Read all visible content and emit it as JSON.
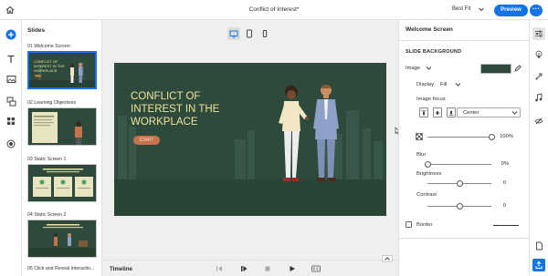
{
  "header": {
    "doc_title": "Conflict of Interest*",
    "fit_label": "Best Fit",
    "preview_label": "Preview",
    "more_label": "···"
  },
  "slides_panel": {
    "title": "Slides",
    "items": [
      {
        "label": "01  Welcome Screen",
        "selected": true
      },
      {
        "label": "02  Learning Objectives",
        "selected": false
      },
      {
        "label": "03  Static Screen 1",
        "selected": false
      },
      {
        "label": "04  Static Screen 2",
        "selected": false
      },
      {
        "label": "05  Click and Reveal Interactio...",
        "selected": false
      }
    ]
  },
  "stage": {
    "title": "CONFLICT OF INTEREST IN THE WORKPLACE",
    "start_label": "START"
  },
  "timeline": {
    "label": "Timeline"
  },
  "properties": {
    "panel_title": "Welcome Screen",
    "section_title": "SLIDE BACKGROUND",
    "image_label": "Image",
    "display_label": "Display",
    "display_value": "Fill",
    "focus_label": "Image focus",
    "focus_value": "Center",
    "opacity_value": "100%",
    "opacity_level": 1.0,
    "blur_label": "Blur",
    "blur_value": "0%",
    "blur_level": 0,
    "brightness_label": "Brightness",
    "brightness_value": "0",
    "brightness_level": 0.5,
    "contrast_label": "Contrast",
    "contrast_value": "0",
    "contrast_level": 0.5,
    "border_label": "Border"
  },
  "colors": {
    "accent": "#1473e6",
    "slide_bg": "#2e4a3c",
    "title_text": "#f1e39b",
    "start_button": "#c5744a"
  }
}
